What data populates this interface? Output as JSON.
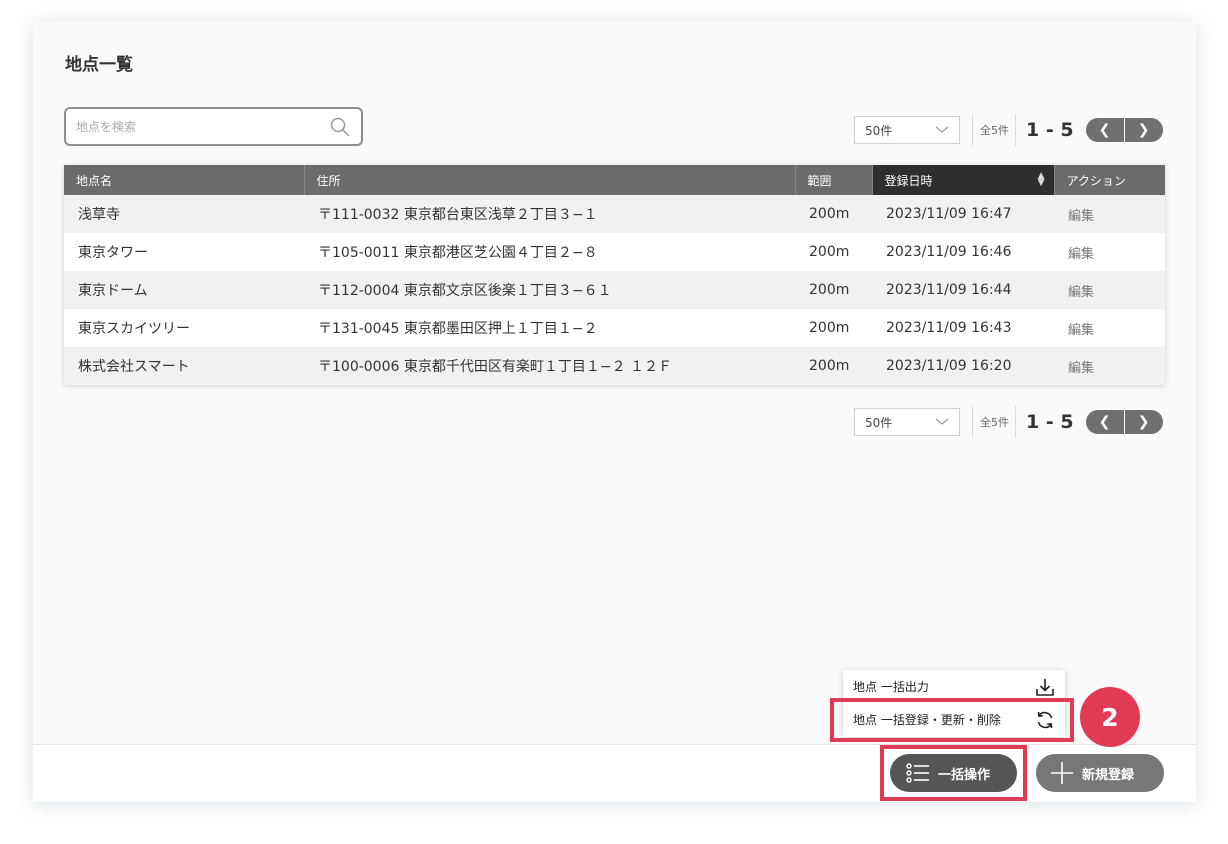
{
  "page": {
    "title": "地点一覧"
  },
  "search": {
    "placeholder": "地点を検索"
  },
  "pager": {
    "per_page": "50件",
    "total": "全5件",
    "range": "1 - 5",
    "prev": "❮",
    "next": "❯"
  },
  "table": {
    "headers": [
      "地点名",
      "住所",
      "範囲",
      "登録日時",
      "アクション"
    ],
    "rows": [
      {
        "name": "浅草寺",
        "address": "〒111-0032 東京都台東区浅草２丁目３−１",
        "range": "200m",
        "date": "2023/11/09 16:47",
        "action": "編集"
      },
      {
        "name": "東京タワー",
        "address": "〒105-0011 東京都港区芝公園４丁目２−８",
        "range": "200m",
        "date": "2023/11/09 16:46",
        "action": "編集"
      },
      {
        "name": "東京ドーム",
        "address": "〒112-0004 東京都文京区後楽１丁目３−６１",
        "range": "200m",
        "date": "2023/11/09 16:44",
        "action": "編集"
      },
      {
        "name": "東京スカイツリー",
        "address": "〒131-0045 東京都墨田区押上１丁目１−２",
        "range": "200m",
        "date": "2023/11/09 16:43",
        "action": "編集"
      },
      {
        "name": "株式会社スマート",
        "address": "〒100-0006 東京都千代田区有楽町１丁目１−２ １２Ｆ",
        "range": "200m",
        "date": "2023/11/09 16:20",
        "action": "編集"
      }
    ]
  },
  "dropdown": {
    "export_label": "地点 一括出力",
    "import_label": "地点 一括登録・更新・削除"
  },
  "annotation": {
    "step": "2",
    "color": "#e03a55"
  },
  "footer": {
    "bulk_label": "一括操作",
    "new_label": "新規登録"
  }
}
